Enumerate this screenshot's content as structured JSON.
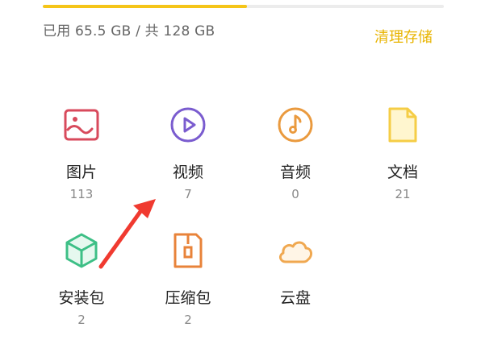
{
  "storage": {
    "used_fraction": 0.51,
    "usage_text": "已用 65.5 GB / 共 128 GB",
    "clean_label": "清理存储",
    "bar_color": "#f5c518",
    "accent_color": "#e8b400"
  },
  "categories": [
    {
      "label": "图片",
      "count": "113",
      "icon": "image-icon",
      "color": "#d84a5c"
    },
    {
      "label": "视频",
      "count": "7",
      "icon": "video-play-icon",
      "color": "#7a5ccf"
    },
    {
      "label": "音频",
      "count": "0",
      "icon": "music-note-icon",
      "color": "#ea9a3e"
    },
    {
      "label": "文档",
      "count": "21",
      "icon": "document-icon",
      "color": "#f5cd46"
    },
    {
      "label": "安装包",
      "count": "2",
      "icon": "package-cube-icon",
      "color": "#3dbf86"
    },
    {
      "label": "压缩包",
      "count": "2",
      "icon": "zip-archive-icon",
      "color": "#e8833a"
    },
    {
      "label": "云盘",
      "count": "",
      "icon": "cloud-icon",
      "color": "#f0a850"
    }
  ],
  "annotation": {
    "arrow_color": "#f03a30"
  }
}
